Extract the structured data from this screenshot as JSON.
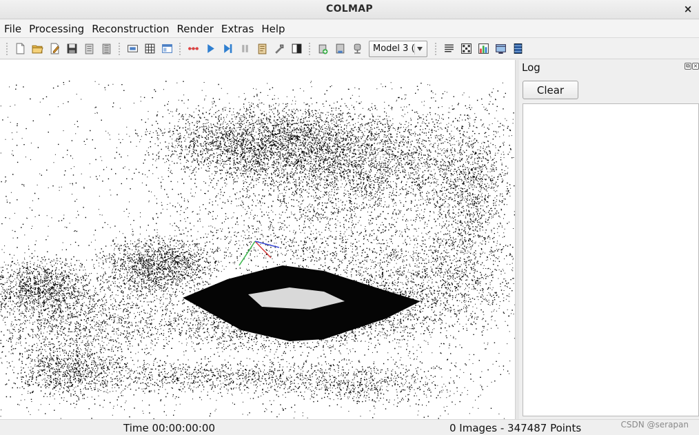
{
  "window": {
    "title": "COLMAP",
    "close_glyph": "×"
  },
  "menu": [
    "File",
    "Processing",
    "Reconstruction",
    "Render",
    "Extras",
    "Help"
  ],
  "toolbar": {
    "groups": [
      [
        "new-project-icon",
        "open-project-icon",
        "edit-project-icon",
        "save-project-icon",
        "import-model-icon",
        "export-model-icon"
      ],
      [
        "feature-extraction-icon",
        "feature-matching-icon",
        "database-management-icon"
      ],
      [
        "automatic-reconstruction-icon",
        "start-reconstruction-icon",
        "step-reconstruction-icon",
        "pause-reconstruction-icon",
        "reconstruction-options-icon",
        "bundle-adjustment-icon",
        "dense-reconstruction-icon"
      ],
      [
        "render-options-icon",
        "reset-view-icon",
        "camera-icon"
      ]
    ],
    "model_select": "Model 3 (",
    "trailing": [
      "reconstruction-stats-icon",
      "match-matrix-icon",
      "log-icon",
      "window-icon",
      "film-icon"
    ]
  },
  "log": {
    "title": "Log",
    "clear_label": "Clear",
    "dock_float": "⧉",
    "dock_close": "×"
  },
  "status": {
    "time": "Time 00:00:00:00",
    "count": "0 Images - 347487 Points"
  },
  "watermark": "CSDN @serapan",
  "colors": {
    "accent": "#2f7fd0",
    "axis_x": "#d43a3a",
    "axis_y": "#38b54a",
    "axis_z": "#3a49d4"
  }
}
